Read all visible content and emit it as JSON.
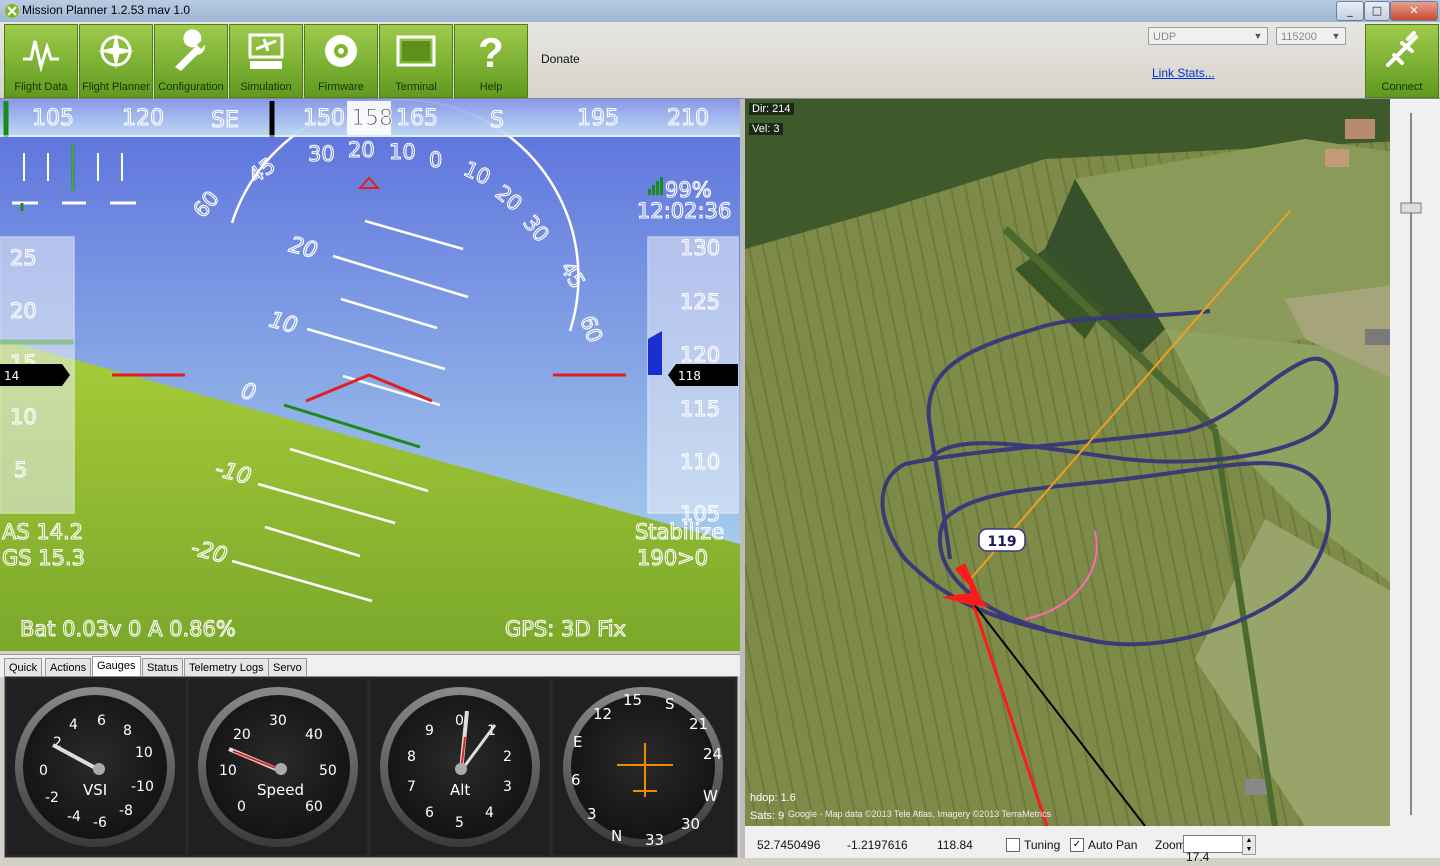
{
  "window": {
    "title": "Mission Planner 1.2.53 mav 1.0",
    "minimize": "_",
    "maximize": "□",
    "close": "✕"
  },
  "toolbar": {
    "buttons": [
      {
        "label": "Flight Data",
        "icon": "flight-data-icon"
      },
      {
        "label": "Flight Planner",
        "icon": "flight-planner-icon"
      },
      {
        "label": "Configuration",
        "icon": "wrench-icon"
      },
      {
        "label": "Simulation",
        "icon": "simulation-icon"
      },
      {
        "label": "Firmware",
        "icon": "firmware-disc-icon"
      },
      {
        "label": "Terminal",
        "icon": "terminal-icon"
      },
      {
        "label": "Help",
        "icon": "help-icon"
      }
    ],
    "donate": "Donate",
    "connection_type": "UDP",
    "baud_rate": "115200",
    "link_stats": "Link Stats...",
    "connect": "Connect"
  },
  "hud": {
    "heading_ticks": [
      "105",
      "120",
      "SE",
      "150",
      "158",
      "165",
      "S",
      "195",
      "210"
    ],
    "current_heading": "158",
    "pitch_labels": [
      "20",
      "10",
      "0",
      "-10",
      "-20"
    ],
    "roll_labels": [
      "60",
      "45",
      "30",
      "20",
      "10",
      "0",
      "10",
      "20",
      "30",
      "45",
      "60"
    ],
    "airspeed_ticks": [
      "25",
      "20",
      "15",
      "10",
      "5"
    ],
    "airspeed_current": "14",
    "altitude_ticks": [
      "130",
      "125",
      "120",
      "115",
      "110",
      "105"
    ],
    "altitude_current": "118",
    "link_quality": "99%",
    "time": "12:02:36",
    "as_label": "AS 14.2",
    "gs_label": "GS 15.3",
    "mode": "Stabilize",
    "waypoint": "190>0",
    "battery": "Bat 0.03v 0 A 0.86%",
    "gps": "GPS: 3D Fix",
    "colors": {
      "sky": "#6f8bd8",
      "ground": "#8fb832",
      "pitch_marker": "#e02020",
      "horizon": "#1a8a1a"
    }
  },
  "tabs": [
    "Quick",
    "Actions",
    "Gauges",
    "Status",
    "Telemetry Logs",
    "Servo"
  ],
  "active_tab": "Gauges",
  "gauges": {
    "vsi": {
      "label": "VSI",
      "ticks": [
        "2",
        "4",
        "6",
        "8",
        "10",
        "0",
        "-2",
        "-4",
        "-6",
        "-8",
        "-10"
      ]
    },
    "speed": {
      "label": "Speed",
      "ticks": [
        "10",
        "20",
        "30",
        "40",
        "50",
        "60",
        "0"
      ]
    },
    "alt": {
      "label": "Alt",
      "ticks": [
        "0",
        "1",
        "2",
        "3",
        "4",
        "5",
        "6",
        "7",
        "8",
        "9"
      ]
    },
    "compass": {
      "ticks": [
        "15",
        "S",
        "21",
        "24",
        "W",
        "30",
        "33",
        "N",
        "3",
        "6",
        "E",
        "12"
      ]
    }
  },
  "map": {
    "dir": "Dir: 214",
    "vel": "Vel: 3",
    "waypoint_label": "119",
    "hdop": "hdop: 1.6",
    "sats": "Sats: 9",
    "attribution": "Google - Map data ©2013 Tele Atlas, Imagery ©2013 TerraMetrics",
    "track_color": "#3a3a78",
    "target_line_color": "#f0a020",
    "heading_line_color": "#ff1a1a"
  },
  "map_status": {
    "lat": "52.7450496",
    "lng": "-1.2197616",
    "alt": "118.84",
    "tuning_label": "Tuning",
    "tuning_checked": false,
    "autopan_label": "Auto Pan",
    "autopan_checked": true,
    "zoom_label": "Zoom",
    "zoom_value": "17.4"
  }
}
